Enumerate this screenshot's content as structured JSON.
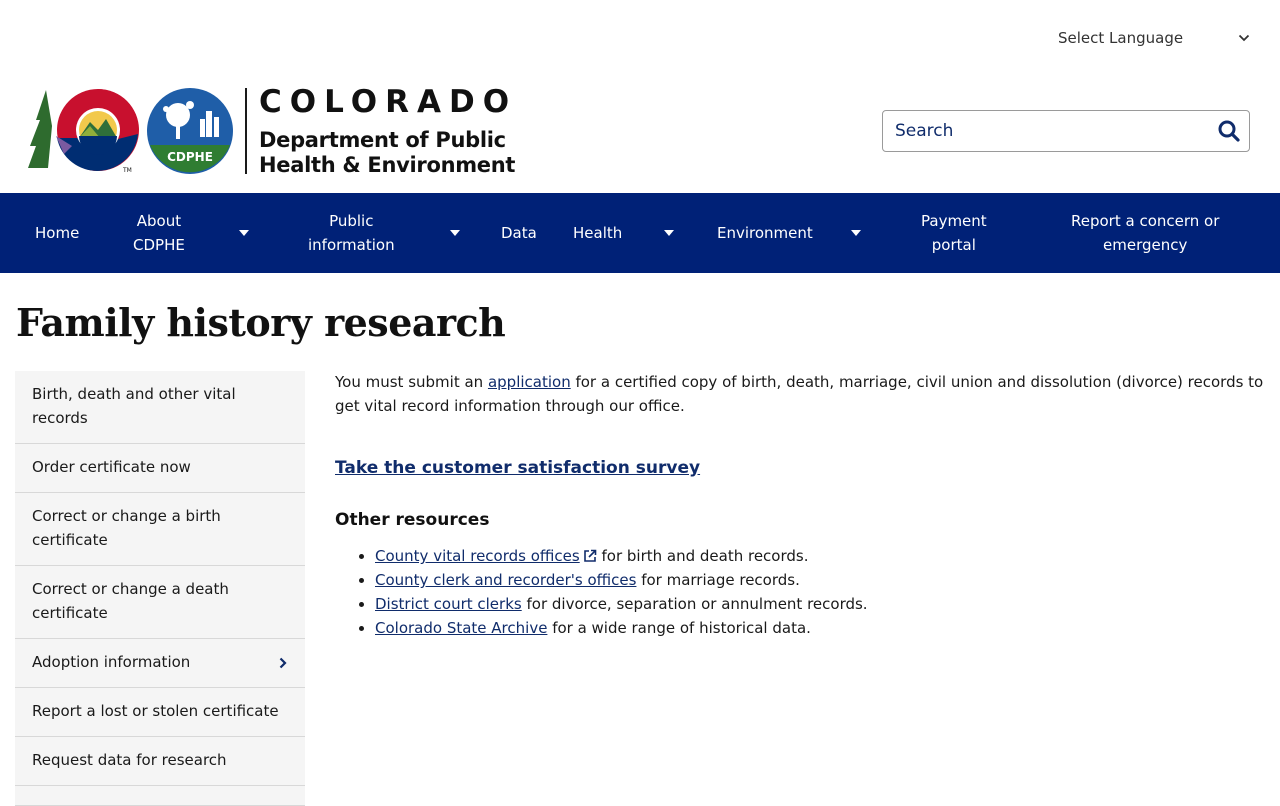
{
  "language_select": {
    "label": "Select Language"
  },
  "logo": {
    "state": "COLORADO",
    "dept_line1": "Department of Public",
    "dept_line2": "Health & Environment",
    "seal_text": "CDPHE"
  },
  "search": {
    "placeholder": "Search"
  },
  "nav": {
    "home": "Home",
    "about_1": "About",
    "about_2": "CDPHE",
    "public_1": "Public",
    "public_2": "information",
    "data": "Data",
    "health": "Health",
    "environment": "Environment",
    "payment_1": "Payment",
    "payment_2": "portal",
    "report_1": "Report a concern or",
    "report_2": "emergency"
  },
  "page": {
    "title": "Family history research"
  },
  "sidebar": {
    "items": [
      {
        "label": "Birth, death and other vital records"
      },
      {
        "label": "Order certificate now"
      },
      {
        "label": "Correct or change a birth certificate"
      },
      {
        "label": "Correct or change a death certificate"
      },
      {
        "label": "Adoption information"
      },
      {
        "label": "Report a lost or stolen certificate"
      },
      {
        "label": "Request data for research"
      }
    ]
  },
  "content": {
    "intro_before": "You must submit an ",
    "intro_link": "application",
    "intro_after": " for a certified copy of birth, death, marriage, civil union and dissolution (divorce) records to get vital record information through our office.",
    "survey_link": "Take the customer satisfaction survey",
    "other_heading": "Other resources",
    "resources": [
      {
        "link": "County vital records offices",
        "text": " for birth and death records."
      },
      {
        "link": "County clerk and recorder's offices",
        "text": " for marriage records."
      },
      {
        "link": "District court clerks",
        "text": " for divorce, separation or annulment records."
      },
      {
        "link": "Colorado State Archive",
        "text": " for a wide range of historical data."
      }
    ]
  },
  "colors": {
    "nav_bg": "#002177",
    "link": "#102c6b",
    "sidebar_bg": "#f5f5f5"
  },
  "icons": {
    "search": "search-icon",
    "caret": "caret-down-icon",
    "chevron": "chevron-right-icon",
    "external": "external-link-icon"
  }
}
